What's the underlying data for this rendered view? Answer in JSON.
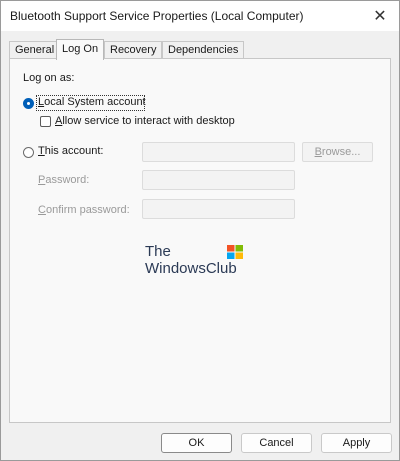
{
  "window": {
    "title": "Bluetooth Support Service Properties (Local Computer)",
    "close_glyph": "✕"
  },
  "tabs": [
    {
      "label": "General"
    },
    {
      "label": "Log On"
    },
    {
      "label": "Recovery"
    },
    {
      "label": "Dependencies"
    }
  ],
  "logon": {
    "heading": "Log on as:",
    "local_system": {
      "label_first": "L",
      "label_rest": "ocal System account",
      "selected": true
    },
    "interact": {
      "label_first": "A",
      "label_rest": "llow service to interact with desktop",
      "checked": false
    },
    "this_account": {
      "label_first": "T",
      "label_rest": "his account:",
      "selected": false,
      "value": ""
    },
    "browse": {
      "label_first": "B",
      "label_rest": "rowse..."
    },
    "password": {
      "label_first": "P",
      "label_rest": "assword:",
      "value": ""
    },
    "confirm": {
      "label_first": "C",
      "label_rest": "onfirm password:",
      "value": ""
    }
  },
  "watermark": {
    "line1": "The",
    "line2": "WindowsClub"
  },
  "buttons": {
    "ok": "OK",
    "cancel": "Cancel",
    "apply": "Apply"
  },
  "colors": {
    "accent": "#005fb8",
    "logo_red": "#f35325",
    "logo_green": "#81bc06",
    "logo_blue": "#05a6f0",
    "logo_yellow": "#ffba08"
  }
}
